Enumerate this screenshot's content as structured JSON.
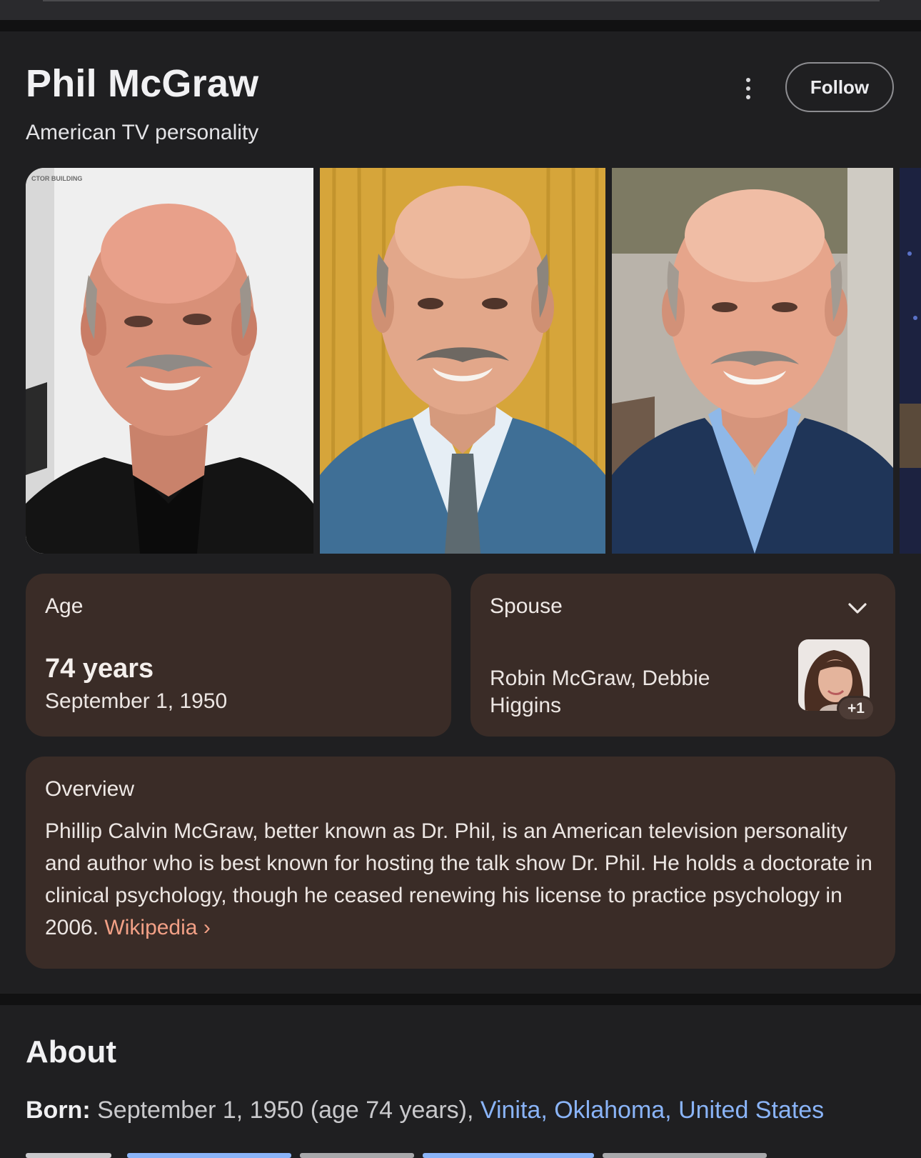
{
  "header": {
    "title": "Phil McGraw",
    "subtitle": "American TV personality",
    "follow_label": "Follow",
    "more_icon": "more-vert-icon"
  },
  "gallery": {
    "photos": [
      {
        "name": "portrait-black-suit"
      },
      {
        "name": "portrait-blue-suit"
      },
      {
        "name": "portrait-navy-suit"
      }
    ],
    "photo1_caption": "CTOR BUILDING"
  },
  "facts": {
    "age": {
      "label": "Age",
      "value": "74 years",
      "date": "September 1, 1950"
    },
    "spouse": {
      "label": "Spouse",
      "names": "Robin McGraw, Debbie Higgins",
      "more_count": "+1",
      "expand_icon": "chevron-down-icon"
    }
  },
  "overview": {
    "label": "Overview",
    "text": "Phillip Calvin McGraw, better known as Dr. Phil, is an American television personality and author who is best known for hosting the talk show Dr. Phil. He holds a doctorate in clinical psychology, though he ceased renewing his license to practice psychology in 2006.",
    "source_link": "Wikipedia",
    "source_chevron": "›"
  },
  "about": {
    "title": "About",
    "born_label": "Born:",
    "born_value": "September 1, 1950 (age 74 years),",
    "born_place": "Vinita, Oklahoma, United States"
  },
  "colors": {
    "background": "#1f1f21",
    "card": "#3a2c27",
    "link_orange": "#f2a086",
    "link_blue": "#8ab4f8"
  }
}
